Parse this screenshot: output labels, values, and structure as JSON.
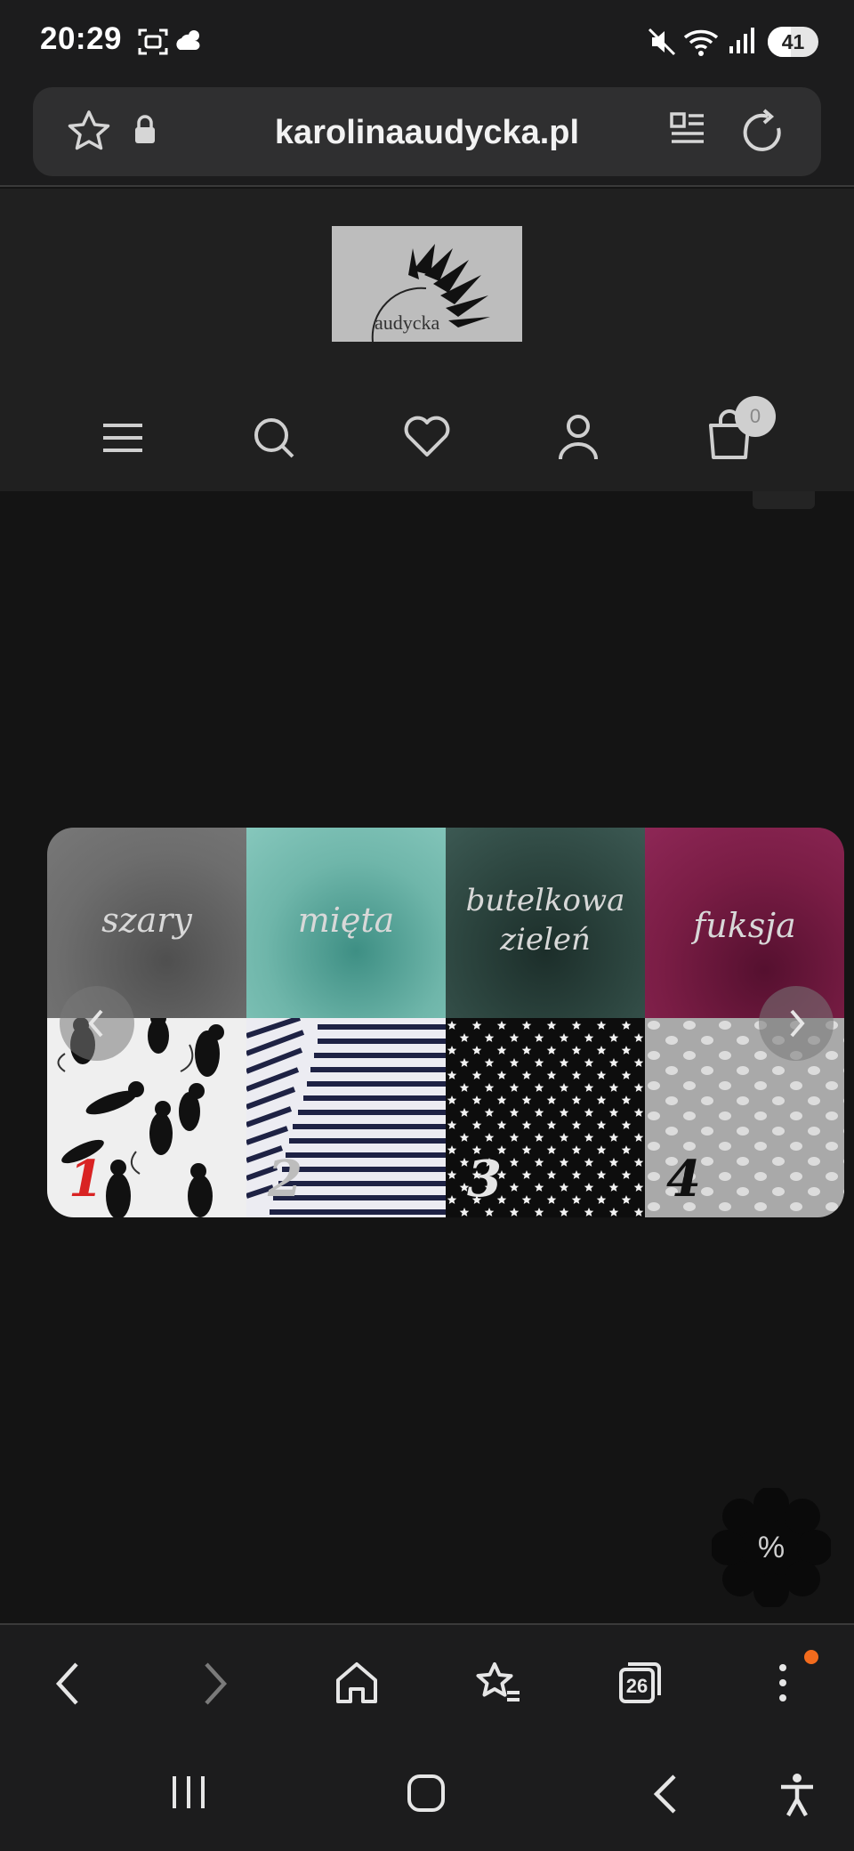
{
  "status_bar": {
    "time": "20:29",
    "battery": "41"
  },
  "browser": {
    "url": "karolinaaudycka.pl"
  },
  "site": {
    "logo_text": "audycka",
    "cart_count": "0"
  },
  "slider": {
    "tiles_top": [
      {
        "label": "szary",
        "color": "#6d6d6d"
      },
      {
        "label": "mięta",
        "color": "#6fb6aa"
      },
      {
        "label": "butelkowa zieleń",
        "color": "#2d4640"
      },
      {
        "label": "fuksja",
        "color": "#7a1d45"
      }
    ],
    "tiles_bottom": [
      {
        "number": "1",
        "color": "#ededed"
      },
      {
        "number": "2",
        "color": "#e8e8ee"
      },
      {
        "number": "3",
        "color": "#101010"
      },
      {
        "number": "4",
        "color": "#a9a9a9"
      }
    ]
  },
  "promo": {
    "symbol": "%"
  },
  "tabs": {
    "count": "26"
  }
}
